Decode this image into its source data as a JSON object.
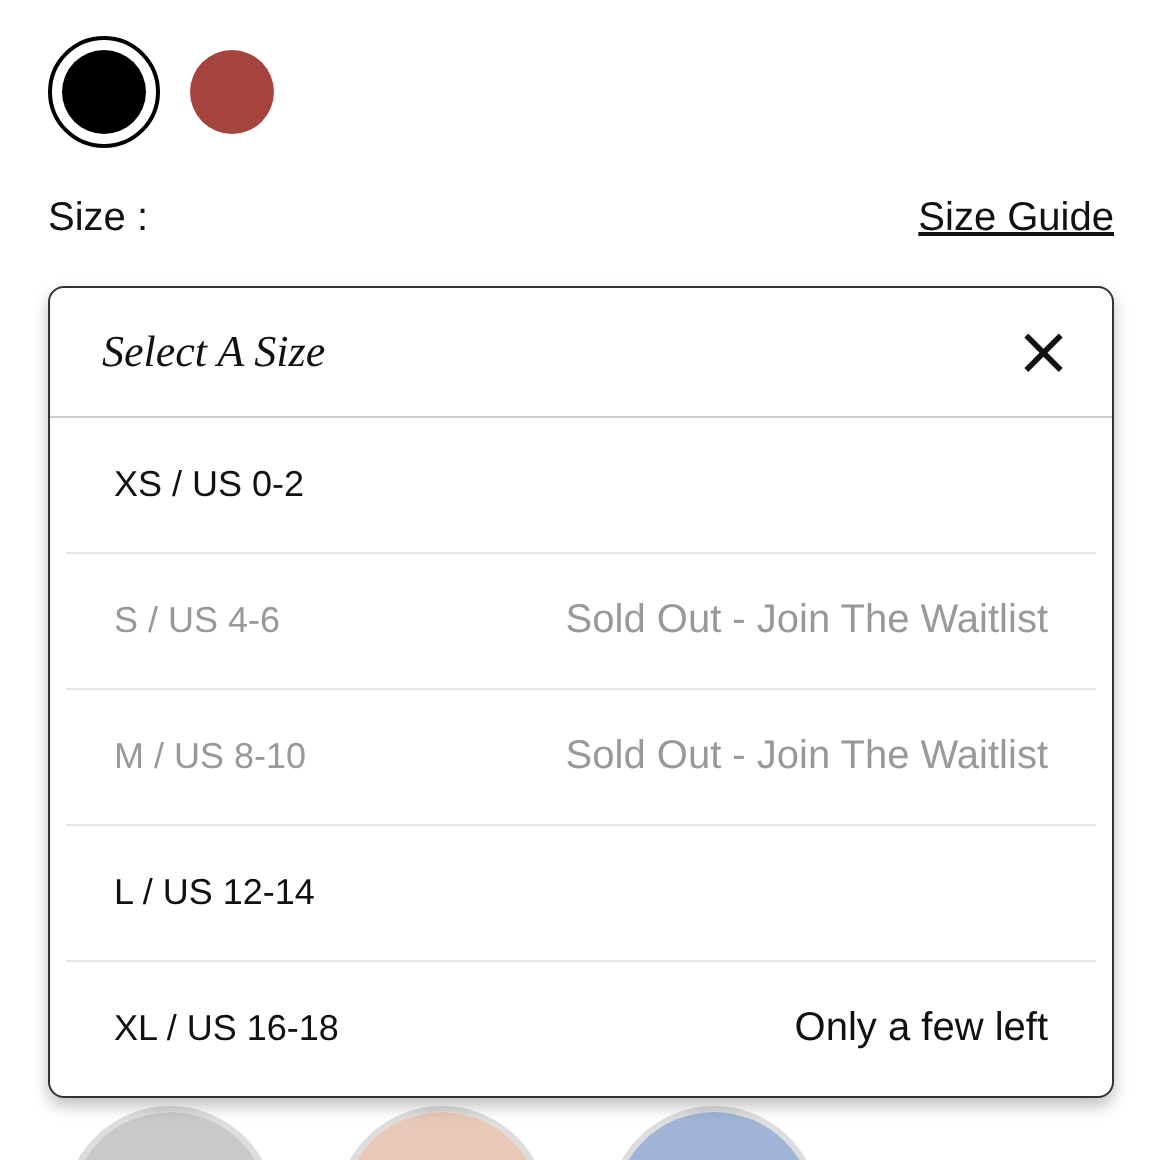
{
  "swatches": [
    {
      "color": "#000000",
      "selected": true
    },
    {
      "color": "#a5443e",
      "selected": false
    }
  ],
  "size_label": "Size :",
  "size_guide": "Size Guide",
  "dropdown": {
    "title": "Select A Size",
    "close": "×",
    "options": [
      {
        "label": "XS / US 0-2",
        "disabled": false
      },
      {
        "label": "S / US 4-6",
        "disabled": true,
        "note": "Sold Out - Join The Waitlist"
      },
      {
        "label": "M / US 8-10",
        "disabled": true,
        "note": "Sold Out - Join The Waitlist"
      },
      {
        "label": "L / US 12-14",
        "disabled": false
      },
      {
        "label": "XL / US 16-18",
        "disabled": false,
        "note": "Only a few left"
      }
    ]
  }
}
